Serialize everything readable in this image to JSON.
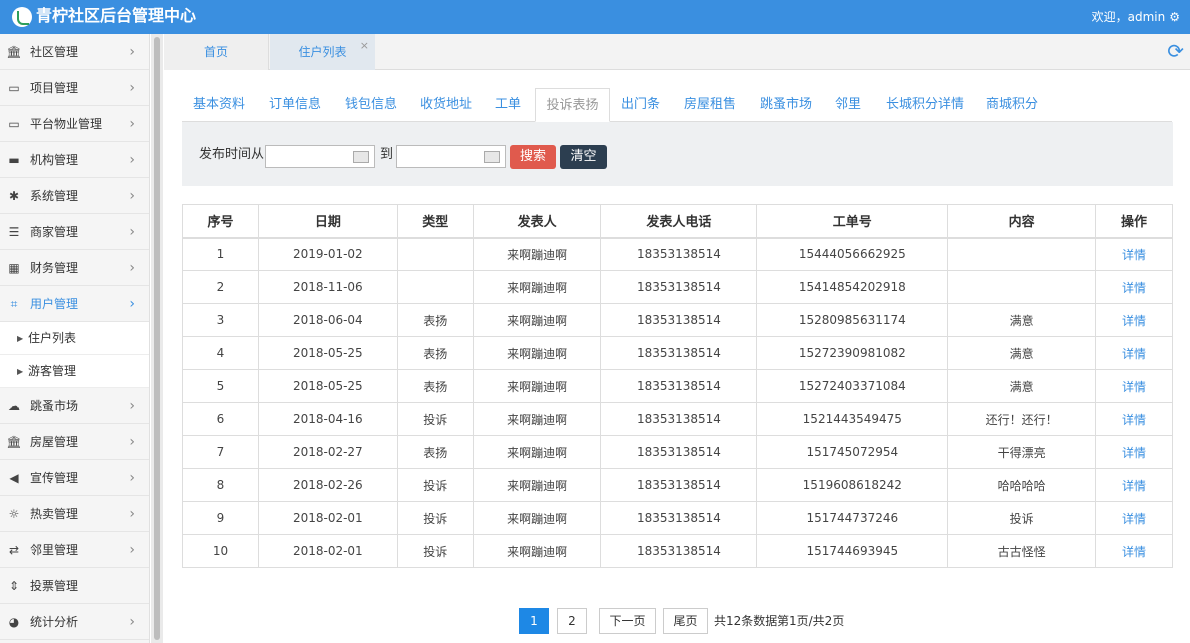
{
  "header": {
    "title": "青柠社区后台管理中心",
    "welcome": "欢迎，admin",
    "settings_icon": "gear-icon"
  },
  "sidebar": {
    "items": [
      {
        "label": "社区管理",
        "icon": "bank-icon"
      },
      {
        "label": "项目管理",
        "icon": "card-icon"
      },
      {
        "label": "平台物业管理",
        "icon": "monitor-icon"
      },
      {
        "label": "机构管理",
        "icon": "stripe-icon"
      },
      {
        "label": "系统管理",
        "icon": "yelp-icon"
      },
      {
        "label": "商家管理",
        "icon": "list-icon"
      },
      {
        "label": "财务管理",
        "icon": "calculator-icon"
      },
      {
        "label": "用户管理",
        "icon": "crop-icon"
      },
      {
        "label": "跳蚤市场",
        "icon": "cloud-icon"
      },
      {
        "label": "房屋管理",
        "icon": "bank-icon"
      },
      {
        "label": "宣传管理",
        "icon": "volume-icon"
      },
      {
        "label": "热卖管理",
        "icon": "sun-icon"
      },
      {
        "label": "邻里管理",
        "icon": "retweet-icon"
      },
      {
        "label": "投票管理",
        "icon": "sort-icon"
      },
      {
        "label": "统计分析",
        "icon": "pie-icon"
      }
    ],
    "sub_items": [
      {
        "label": "住户列表"
      },
      {
        "label": "游客管理"
      }
    ]
  },
  "page_tabs": [
    {
      "label": "首页"
    },
    {
      "label": "住户列表",
      "close": "×"
    }
  ],
  "sub_tabs": [
    "基本资料",
    "订单信息",
    "钱包信息",
    "收货地址",
    "工单",
    "投诉表扬",
    "出门条",
    "房屋租售",
    "跳蚤市场",
    "邻里",
    "长城积分详情",
    "商城积分"
  ],
  "filter": {
    "from_label": "发布时间从",
    "to_label": "到",
    "from_value": "",
    "to_value": "",
    "search_label": "搜索",
    "clear_label": "清空"
  },
  "table": {
    "headers": [
      "序号",
      "日期",
      "类型",
      "发表人",
      "发表人电话",
      "工单号",
      "内容",
      "操作"
    ],
    "rows": [
      [
        "1",
        "2019-01-02",
        "",
        "来啊蹦迪啊",
        "18353138514",
        "15444056662925",
        "",
        "详情"
      ],
      [
        "2",
        "2018-11-06",
        "",
        "来啊蹦迪啊",
        "18353138514",
        "15414854202918",
        "",
        "详情"
      ],
      [
        "3",
        "2018-06-04",
        "表扬",
        "来啊蹦迪啊",
        "18353138514",
        "15280985631174",
        "满意",
        "详情"
      ],
      [
        "4",
        "2018-05-25",
        "表扬",
        "来啊蹦迪啊",
        "18353138514",
        "15272390981082",
        "满意",
        "详情"
      ],
      [
        "5",
        "2018-05-25",
        "表扬",
        "来啊蹦迪啊",
        "18353138514",
        "15272403371084",
        "满意",
        "详情"
      ],
      [
        "6",
        "2018-04-16",
        "投诉",
        "来啊蹦迪啊",
        "18353138514",
        "1521443549475",
        "还行！还行！",
        "详情"
      ],
      [
        "7",
        "2018-02-27",
        "表扬",
        "来啊蹦迪啊",
        "18353138514",
        "151745072954",
        "干得漂亮",
        "详情"
      ],
      [
        "8",
        "2018-02-26",
        "投诉",
        "来啊蹦迪啊",
        "18353138514",
        "1519608618242",
        "哈哈哈哈",
        "详情"
      ],
      [
        "9",
        "2018-02-01",
        "投诉",
        "来啊蹦迪啊",
        "18353138514",
        "151744737246",
        "投诉",
        "详情"
      ],
      [
        "10",
        "2018-02-01",
        "投诉",
        "来啊蹦迪啊",
        "18353138514",
        "151744693945",
        "古古怪怪",
        "详情"
      ]
    ]
  },
  "pagination": {
    "pages": [
      "1",
      "2"
    ],
    "current": "1",
    "next_label": "下一页",
    "last_label": "尾页",
    "summary": "共12条数据",
    "page_info": "第1页/共2页"
  },
  "colors": {
    "header_bg": "#3a8fe0",
    "accent": "#3a8fe0",
    "search_btn": "#e05a4d",
    "clear_btn": "#2c3e50"
  }
}
